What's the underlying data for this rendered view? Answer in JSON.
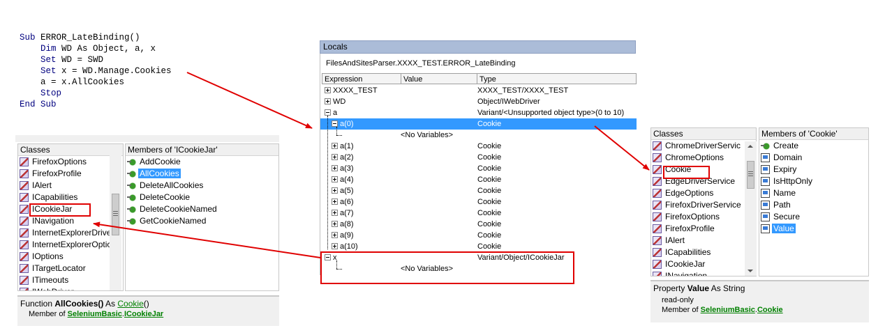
{
  "code": {
    "lines": [
      {
        "kw": "Sub ",
        "tx": "ERROR_LateBinding()"
      },
      {
        "kw": "    Dim ",
        "tx": "WD As Object, a, x"
      },
      {
        "kw": "    Set ",
        "tx": "WD = SWD"
      },
      {
        "kw": "    Set ",
        "tx": "x = WD.Manage.Cookies"
      },
      {
        "kw": "    ",
        "tx": "a = x.AllCookies"
      },
      {
        "kw": "    Stop",
        "tx": ""
      },
      {
        "kw": "End Sub",
        "tx": ""
      }
    ]
  },
  "left_browser": {
    "classes_header": "Classes",
    "members_header": "Members of 'ICookieJar'",
    "classes": [
      "FirefoxOptions",
      "FirefoxProfile",
      "IAlert",
      "ICapabilities",
      "ICookieJar",
      "INavigation",
      "InternetExplorerDrive",
      "InternetExplorerOptic",
      "IOptions",
      "ITargetLocator",
      "ITimeouts",
      "IWebDriver"
    ],
    "members": [
      "AddCookie",
      "AllCookies",
      "DeleteAllCookies",
      "DeleteCookie",
      "DeleteCookieNamed",
      "GetCookieNamed"
    ],
    "selected_member": "AllCookies",
    "info": {
      "prefix": "Function ",
      "name": "AllCookies()",
      "as": " As ",
      "type": "Cookie",
      "suffix": "()",
      "member_of": "Member of ",
      "lib": "SeleniumBasic",
      "dot": ".",
      "cls": "ICookieJar"
    }
  },
  "locals": {
    "title": "Locals",
    "context": "FilesAndSitesParser.XXXX_TEST.ERROR_LateBinding",
    "columns": [
      "Expression",
      "Value",
      "Type"
    ],
    "rows": [
      {
        "exp": "XXXX_TEST",
        "val": "",
        "typ": "XXXX_TEST/XXXX_TEST",
        "indent": 0,
        "pm": "plus"
      },
      {
        "exp": "WD",
        "val": "",
        "typ": "Object/IWebDriver",
        "indent": 0,
        "pm": "plus"
      },
      {
        "exp": "a",
        "val": "",
        "typ": "Variant/<Unsupported object type>(0 to 10)",
        "indent": 0,
        "pm": "minus"
      },
      {
        "exp": "a(0)",
        "val": "",
        "typ": "Cookie",
        "indent": 1,
        "pm": "minus",
        "hl": true
      },
      {
        "exp": "",
        "val": "<No Variables>",
        "typ": "",
        "indent": 2,
        "pm": "none"
      },
      {
        "exp": "a(1)",
        "val": "",
        "typ": "Cookie",
        "indent": 1,
        "pm": "plus"
      },
      {
        "exp": "a(2)",
        "val": "",
        "typ": "Cookie",
        "indent": 1,
        "pm": "plus"
      },
      {
        "exp": "a(3)",
        "val": "",
        "typ": "Cookie",
        "indent": 1,
        "pm": "plus"
      },
      {
        "exp": "a(4)",
        "val": "",
        "typ": "Cookie",
        "indent": 1,
        "pm": "plus"
      },
      {
        "exp": "a(5)",
        "val": "",
        "typ": "Cookie",
        "indent": 1,
        "pm": "plus"
      },
      {
        "exp": "a(6)",
        "val": "",
        "typ": "Cookie",
        "indent": 1,
        "pm": "plus"
      },
      {
        "exp": "a(7)",
        "val": "",
        "typ": "Cookie",
        "indent": 1,
        "pm": "plus"
      },
      {
        "exp": "a(8)",
        "val": "",
        "typ": "Cookie",
        "indent": 1,
        "pm": "plus"
      },
      {
        "exp": "a(9)",
        "val": "",
        "typ": "Cookie",
        "indent": 1,
        "pm": "plus"
      },
      {
        "exp": "a(10)",
        "val": "",
        "typ": "Cookie",
        "indent": 1,
        "pm": "plus"
      },
      {
        "exp": "x",
        "val": "",
        "typ": "Variant/Object/ICookieJar",
        "indent": 0,
        "pm": "minus"
      },
      {
        "exp": "",
        "val": "<No Variables>",
        "typ": "",
        "indent": 2,
        "pm": "none"
      }
    ]
  },
  "right_browser": {
    "classes_header": "Classes",
    "members_header": "Members of 'Cookie'",
    "classes": [
      "ChromeDriverServic",
      "ChromeOptions",
      "Cookie",
      "EdgeDriverService",
      "EdgeOptions",
      "FirefoxDriverService",
      "FirefoxOptions",
      "FirefoxProfile",
      "IAlert",
      "ICapabilities",
      "ICookieJar",
      "INavigation"
    ],
    "members": [
      "Create",
      "Domain",
      "Expiry",
      "IsHttpOnly",
      "Name",
      "Path",
      "Secure",
      "Value"
    ],
    "selected_member": "Value",
    "info": {
      "prefix": "Property ",
      "name": "Value",
      "as": " As String",
      "readonly": "read-only",
      "member_of": "Member of ",
      "lib": "SeleniumBasic",
      "dot": ".",
      "cls": "Cookie"
    }
  },
  "colors": {
    "annotation": "#e00000",
    "selection": "#3399ff",
    "keyword": "#00007f",
    "link": "#008000"
  }
}
